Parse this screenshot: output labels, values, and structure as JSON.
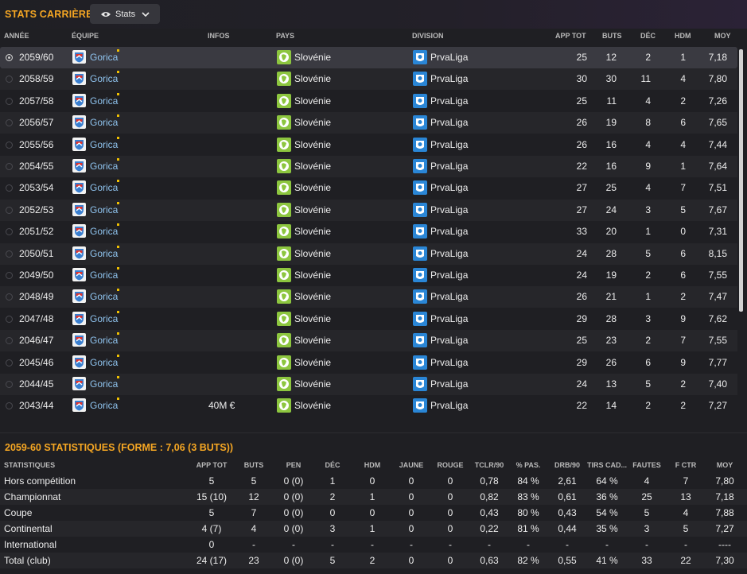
{
  "header": {
    "title": "STATS CARRIÈRE",
    "dropdown_label": "Stats"
  },
  "colors": {
    "accent": "#f5a623",
    "team_link": "#8fc3ee",
    "selected_row": "#3a3a41"
  },
  "career_table": {
    "columns": [
      "ANNÉE",
      "ÉQUIPE",
      "INFOS",
      "PAYS",
      "DIVISION",
      "APP TOT",
      "BUTS",
      "DÉC",
      "HDM",
      "MOY"
    ],
    "rows": [
      {
        "year": "2059/60",
        "team": "Gorica",
        "info": "",
        "country": "Slovénie",
        "division": "PrvaLiga",
        "app": "25",
        "goals": "12",
        "assists": "2",
        "pom": "1",
        "avg": "7,18"
      },
      {
        "year": "2058/59",
        "team": "Gorica",
        "info": "",
        "country": "Slovénie",
        "division": "PrvaLiga",
        "app": "30",
        "goals": "30",
        "assists": "11",
        "pom": "4",
        "avg": "7,80"
      },
      {
        "year": "2057/58",
        "team": "Gorica",
        "info": "",
        "country": "Slovénie",
        "division": "PrvaLiga",
        "app": "25",
        "goals": "11",
        "assists": "4",
        "pom": "2",
        "avg": "7,26"
      },
      {
        "year": "2056/57",
        "team": "Gorica",
        "info": "",
        "country": "Slovénie",
        "division": "PrvaLiga",
        "app": "26",
        "goals": "19",
        "assists": "8",
        "pom": "6",
        "avg": "7,65"
      },
      {
        "year": "2055/56",
        "team": "Gorica",
        "info": "",
        "country": "Slovénie",
        "division": "PrvaLiga",
        "app": "26",
        "goals": "16",
        "assists": "4",
        "pom": "4",
        "avg": "7,44"
      },
      {
        "year": "2054/55",
        "team": "Gorica",
        "info": "",
        "country": "Slovénie",
        "division": "PrvaLiga",
        "app": "22",
        "goals": "16",
        "assists": "9",
        "pom": "1",
        "avg": "7,64"
      },
      {
        "year": "2053/54",
        "team": "Gorica",
        "info": "",
        "country": "Slovénie",
        "division": "PrvaLiga",
        "app": "27",
        "goals": "25",
        "assists": "4",
        "pom": "7",
        "avg": "7,51"
      },
      {
        "year": "2052/53",
        "team": "Gorica",
        "info": "",
        "country": "Slovénie",
        "division": "PrvaLiga",
        "app": "27",
        "goals": "24",
        "assists": "3",
        "pom": "5",
        "avg": "7,67"
      },
      {
        "year": "2051/52",
        "team": "Gorica",
        "info": "",
        "country": "Slovénie",
        "division": "PrvaLiga",
        "app": "33",
        "goals": "20",
        "assists": "1",
        "pom": "0",
        "avg": "7,31"
      },
      {
        "year": "2050/51",
        "team": "Gorica",
        "info": "",
        "country": "Slovénie",
        "division": "PrvaLiga",
        "app": "24",
        "goals": "28",
        "assists": "5",
        "pom": "6",
        "avg": "8,15"
      },
      {
        "year": "2049/50",
        "team": "Gorica",
        "info": "",
        "country": "Slovénie",
        "division": "PrvaLiga",
        "app": "24",
        "goals": "19",
        "assists": "2",
        "pom": "6",
        "avg": "7,55"
      },
      {
        "year": "2048/49",
        "team": "Gorica",
        "info": "",
        "country": "Slovénie",
        "division": "PrvaLiga",
        "app": "26",
        "goals": "21",
        "assists": "1",
        "pom": "2",
        "avg": "7,47"
      },
      {
        "year": "2047/48",
        "team": "Gorica",
        "info": "",
        "country": "Slovénie",
        "division": "PrvaLiga",
        "app": "29",
        "goals": "28",
        "assists": "3",
        "pom": "9",
        "avg": "7,62"
      },
      {
        "year": "2046/47",
        "team": "Gorica",
        "info": "",
        "country": "Slovénie",
        "division": "PrvaLiga",
        "app": "25",
        "goals": "23",
        "assists": "2",
        "pom": "7",
        "avg": "7,55"
      },
      {
        "year": "2045/46",
        "team": "Gorica",
        "info": "",
        "country": "Slovénie",
        "division": "PrvaLiga",
        "app": "29",
        "goals": "26",
        "assists": "6",
        "pom": "9",
        "avg": "7,77"
      },
      {
        "year": "2044/45",
        "team": "Gorica",
        "info": "",
        "country": "Slovénie",
        "division": "PrvaLiga",
        "app": "24",
        "goals": "13",
        "assists": "5",
        "pom": "2",
        "avg": "7,40"
      },
      {
        "year": "2043/44",
        "team": "Gorica",
        "info": "40M €",
        "country": "Slovénie",
        "division": "PrvaLiga",
        "app": "22",
        "goals": "14",
        "assists": "2",
        "pom": "2",
        "avg": "7,27"
      }
    ]
  },
  "season_stats": {
    "title": "2059-60 STATISTIQUES (FORME : 7,06 (3 BUTS))",
    "columns": [
      "STATISTIQUES",
      "APP TOT",
      "BUTS",
      "PEN",
      "DÉC",
      "HDM",
      "JAUNE",
      "ROUGE",
      "TCLR/90",
      "% PAS.",
      "DRB/90",
      "TIRS CAD...",
      "FAUTES",
      "F CTR",
      "MOY"
    ],
    "rows": [
      [
        "Hors compétition",
        "5",
        "5",
        "0 (0)",
        "1",
        "0",
        "0",
        "0",
        "0,78",
        "84 %",
        "2,61",
        "64 %",
        "4",
        "7",
        "7,80"
      ],
      [
        "Championnat",
        "15 (10)",
        "12",
        "0 (0)",
        "2",
        "1",
        "0",
        "0",
        "0,82",
        "83 %",
        "0,61",
        "36 %",
        "25",
        "13",
        "7,18"
      ],
      [
        "Coupe",
        "5",
        "7",
        "0 (0)",
        "0",
        "0",
        "0",
        "0",
        "0,43",
        "80 %",
        "0,43",
        "54 %",
        "5",
        "4",
        "7,88"
      ],
      [
        "Continental",
        "4 (7)",
        "4",
        "0 (0)",
        "3",
        "1",
        "0",
        "0",
        "0,22",
        "81 %",
        "0,44",
        "35 %",
        "3",
        "5",
        "7,27"
      ],
      [
        "International",
        "0",
        "-",
        "-",
        "-",
        "-",
        "-",
        "-",
        "-",
        "-",
        "-",
        "-",
        "-",
        "-",
        "----"
      ],
      [
        "Total (club)",
        "24 (17)",
        "23",
        "0 (0)",
        "5",
        "2",
        "0",
        "0",
        "0,63",
        "82 %",
        "0,55",
        "41 %",
        "33",
        "22",
        "7,30"
      ]
    ]
  }
}
